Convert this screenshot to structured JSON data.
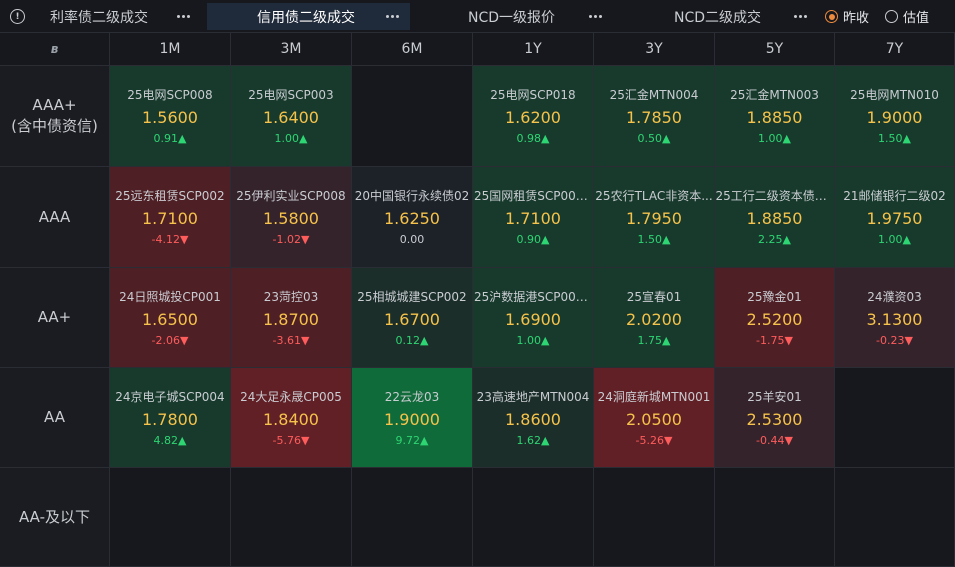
{
  "tabs": [
    {
      "label": "利率债二级成交",
      "active": false
    },
    {
      "label": "信用债二级成交",
      "active": true
    },
    {
      "label": "NCD一级报价",
      "active": false
    },
    {
      "label": "NCD二级成交",
      "active": false
    }
  ],
  "options": [
    {
      "label": "昨收",
      "checked": true
    },
    {
      "label": "估值",
      "checked": false
    }
  ],
  "columns": [
    "1M",
    "3M",
    "6M",
    "1Y",
    "3Y",
    "5Y",
    "7Y"
  ],
  "rows": [
    {
      "rating": "AAA+",
      "rating_sub": "(含中债资信)",
      "cells": [
        {
          "bond": "25电网SCP008",
          "rate": "1.5600",
          "change": "0.91▲",
          "trend": "up",
          "tone": "g1"
        },
        {
          "bond": "25电网SCP003",
          "rate": "1.6400",
          "change": "1.00▲",
          "trend": "up",
          "tone": "g1"
        },
        null,
        {
          "bond": "25电网SCP018",
          "rate": "1.6200",
          "change": "0.98▲",
          "trend": "up",
          "tone": "g1"
        },
        {
          "bond": "25汇金MTN004",
          "rate": "1.7850",
          "change": "0.50▲",
          "trend": "up",
          "tone": "g1"
        },
        {
          "bond": "25汇金MTN003",
          "rate": "1.8850",
          "change": "1.00▲",
          "trend": "up",
          "tone": "g1"
        },
        {
          "bond": "25电网MTN010",
          "rate": "1.9000",
          "change": "1.50▲",
          "trend": "up",
          "tone": "g1"
        }
      ]
    },
    {
      "rating": "AAA",
      "rating_sub": "",
      "cells": [
        {
          "bond": "25远东租赁SCP002",
          "rate": "1.7100",
          "change": "-4.12▼",
          "trend": "down",
          "tone": "r1"
        },
        {
          "bond": "25伊利实业SCP008",
          "rate": "1.5800",
          "change": "-1.02▼",
          "trend": "down",
          "tone": "r0"
        },
        {
          "bond": "20中国银行永续债02",
          "rate": "1.6250",
          "change": "0.00",
          "trend": "flat",
          "tone": "n0"
        },
        {
          "bond": "25国网租赁SCP007...",
          "rate": "1.7100",
          "change": "0.90▲",
          "trend": "up",
          "tone": "g1"
        },
        {
          "bond": "25农行TLAC非资本...",
          "rate": "1.7950",
          "change": "1.50▲",
          "trend": "up",
          "tone": "g1"
        },
        {
          "bond": "25工行二级资本债0...",
          "rate": "1.8850",
          "change": "2.25▲",
          "trend": "up",
          "tone": "g1"
        },
        {
          "bond": "21邮储银行二级02",
          "rate": "1.9750",
          "change": "1.00▲",
          "trend": "up",
          "tone": "g1"
        }
      ]
    },
    {
      "rating": "AA+",
      "rating_sub": "",
      "cells": [
        {
          "bond": "24日照城投CP001",
          "rate": "1.6500",
          "change": "-2.06▼",
          "trend": "down",
          "tone": "r1"
        },
        {
          "bond": "23菏控03",
          "rate": "1.8700",
          "change": "-3.61▼",
          "trend": "down",
          "tone": "r1"
        },
        {
          "bond": "25相城城建SCP002",
          "rate": "1.6700",
          "change": "0.12▲",
          "trend": "up",
          "tone": "g0"
        },
        {
          "bond": "25沪数据港SCP002...",
          "rate": "1.6900",
          "change": "1.00▲",
          "trend": "up",
          "tone": "g1"
        },
        {
          "bond": "25宣春01",
          "rate": "2.0200",
          "change": "1.75▲",
          "trend": "up",
          "tone": "g1"
        },
        {
          "bond": "25豫金01",
          "rate": "2.5200",
          "change": "-1.75▼",
          "trend": "down",
          "tone": "r1"
        },
        {
          "bond": "24濮资03",
          "rate": "3.1300",
          "change": "-0.23▼",
          "trend": "down",
          "tone": "r0"
        }
      ]
    },
    {
      "rating": "AA",
      "rating_sub": "",
      "cells": [
        {
          "bond": "24京电子城SCP004",
          "rate": "1.7800",
          "change": "4.82▲",
          "trend": "up",
          "tone": "g1"
        },
        {
          "bond": "24大足永晟CP005",
          "rate": "1.8400",
          "change": "-5.76▼",
          "trend": "down",
          "tone": "r2"
        },
        {
          "bond": "22云龙03",
          "rate": "1.9000",
          "change": "9.72▲",
          "trend": "up",
          "tone": "g2"
        },
        {
          "bond": "23高速地产MTN004",
          "rate": "1.8600",
          "change": "1.62▲",
          "trend": "up",
          "tone": "g0"
        },
        {
          "bond": "24洞庭新城MTN001",
          "rate": "2.0500",
          "change": "-5.26▼",
          "trend": "down",
          "tone": "r2"
        },
        {
          "bond": "25羊安01",
          "rate": "2.5300",
          "change": "-0.44▼",
          "trend": "down",
          "tone": "r0"
        },
        null
      ]
    },
    {
      "rating": "AA-及以下",
      "rating_sub": "",
      "cells": [
        null,
        null,
        null,
        null,
        null,
        null,
        null
      ]
    }
  ]
}
